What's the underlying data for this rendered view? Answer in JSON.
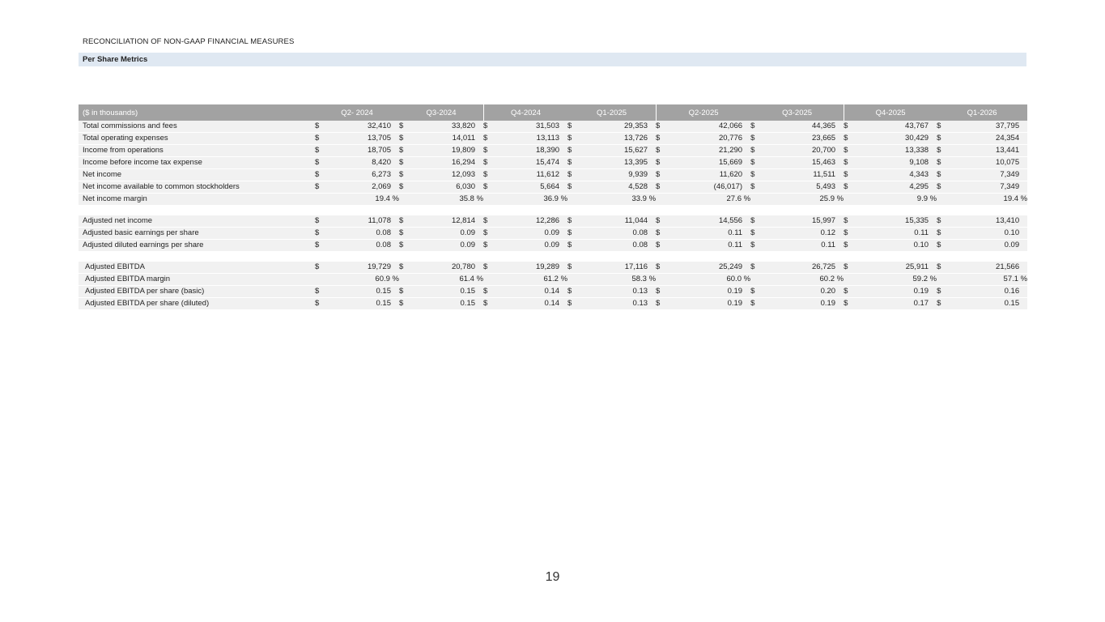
{
  "document": {
    "title": "RECONCILIATION OF NON-GAAP FINANCIAL MEASURES",
    "section": "Per Share Metrics",
    "page_number": "19"
  },
  "table": {
    "label_header": "($ in thousands)",
    "periods": [
      "Q2- 2024",
      "Q3-2024",
      "Q4-2024",
      "Q1-2025",
      "Q2-2025",
      "Q3-2025",
      "Q4-2025",
      "Q1-2026"
    ],
    "currency_symbol": "$",
    "groups": [
      {
        "indent": false,
        "rows": [
          {
            "label": "Total commissions and fees",
            "kind": "currency",
            "values": [
              "32,410",
              "33,820",
              "31,503",
              "29,353",
              "42,066",
              "44,365",
              "43,767",
              "37,795"
            ]
          },
          {
            "label": "Total operating expenses",
            "kind": "currency",
            "values": [
              "13,705",
              "14,011",
              "13,113",
              "13,726",
              "20,776",
              "23,665",
              "30,429",
              "24,354"
            ]
          },
          {
            "label": "Income from operations",
            "kind": "currency",
            "values": [
              "18,705",
              "19,809",
              "18,390",
              "15,627",
              "21,290",
              "20,700",
              "13,338",
              "13,441"
            ]
          },
          {
            "label": "Income before income tax expense",
            "kind": "currency",
            "values": [
              "8,420",
              "16,294",
              "15,474",
              "13,395",
              "15,669",
              "15,463",
              "9,108",
              "10,075"
            ]
          },
          {
            "label": "Net income",
            "kind": "currency",
            "values": [
              "6,273",
              "12,093",
              "11,612",
              "9,939",
              "11,620",
              "11,511",
              "4,343",
              "7,349"
            ]
          },
          {
            "label": "Net income available to common stockholders",
            "kind": "currency",
            "values": [
              "2,069",
              "6,030",
              "5,664",
              "4,528",
              "(46,017)",
              "5,493",
              "4,295",
              "7,349"
            ]
          },
          {
            "label": "Net income margin",
            "kind": "percent",
            "values": [
              "19.4 %",
              "35.8 %",
              "36.9 %",
              "33.9 %",
              "27.6 %",
              "25.9 %",
              "9.9 %",
              "19.4 %"
            ]
          }
        ]
      },
      {
        "indent": false,
        "rows": [
          {
            "label": "Adjusted net income",
            "kind": "currency",
            "values": [
              "11,078",
              "12,814",
              "12,286",
              "11,044",
              "14,556",
              "15,997",
              "15,335",
              "13,410"
            ]
          },
          {
            "label": "Adjusted basic earnings per share",
            "kind": "currency",
            "values": [
              "0.08",
              "0.09",
              "0.09",
              "0.08",
              "0.11",
              "0.12",
              "0.11",
              "0.10"
            ]
          },
          {
            "label": "Adjusted diluted earnings per share",
            "kind": "currency",
            "values": [
              "0.08",
              "0.09",
              "0.09",
              "0.08",
              "0.11",
              "0.11",
              "0.10",
              "0.09"
            ]
          }
        ]
      },
      {
        "indent": true,
        "rows": [
          {
            "label": "Adjusted EBITDA",
            "kind": "currency",
            "values": [
              "19,729",
              "20,780",
              "19,289",
              "17,116",
              "25,249",
              "26,725",
              "25,911",
              "21,566"
            ]
          },
          {
            "label": "Adjusted EBITDA margin",
            "kind": "percent",
            "values": [
              "60.9 %",
              "61.4 %",
              "61.2 %",
              "58.3 %",
              "60.0 %",
              "60.2 %",
              "59.2 %",
              "57.1 %"
            ]
          },
          {
            "label": "Adjusted EBITDA per share (basic)",
            "kind": "currency",
            "values": [
              "0.15",
              "0.15",
              "0.14",
              "0.13",
              "0.19",
              "0.20",
              "0.19",
              "0.16"
            ]
          },
          {
            "label": "Adjusted EBITDA per share (diluted)",
            "kind": "currency",
            "values": [
              "0.15",
              "0.15",
              "0.14",
              "0.13",
              "0.19",
              "0.19",
              "0.17",
              "0.15"
            ]
          }
        ]
      }
    ]
  },
  "colors": {
    "header_bg": "#a2a2a2",
    "section_bg": "#dfe8f2",
    "row_bg": "#f1f1f1"
  }
}
